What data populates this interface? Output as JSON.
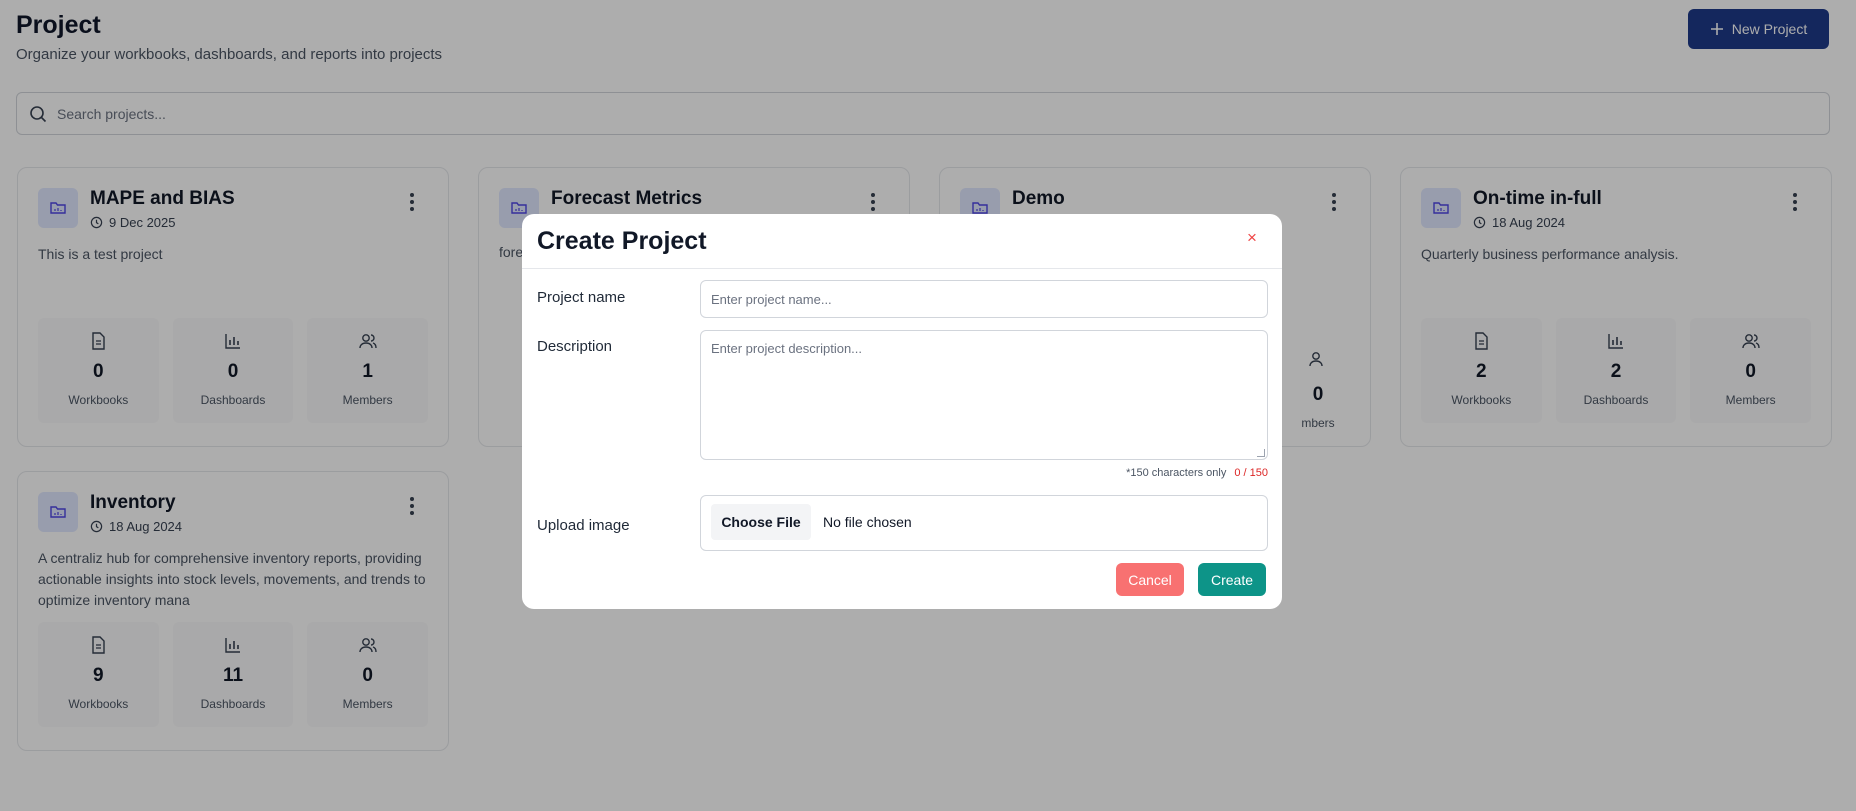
{
  "header": {
    "title": "Project",
    "subtitle": "Organize your workbooks, dashboards, and reports into projects",
    "new_button_label": "New Project"
  },
  "search": {
    "placeholder": "Search projects..."
  },
  "projects": [
    {
      "name": "MAPE and BIAS",
      "date": "9 Dec 2025",
      "description": "This is a test project",
      "workbooks": "0",
      "dashboards": "0",
      "members": "1"
    },
    {
      "name": "Forecast Metrics",
      "date": "",
      "description": "fore",
      "workbooks": "",
      "dashboards": "",
      "members": ""
    },
    {
      "name": "Demo",
      "date": "",
      "description": "",
      "workbooks": "",
      "dashboards": "",
      "members": "0"
    },
    {
      "name": "On-time in-full",
      "date": "18 Aug 2024",
      "description": "Quarterly business performance analysis.",
      "workbooks": "2",
      "dashboards": "2",
      "members": "0"
    },
    {
      "name": "Inventory",
      "date": "18 Aug 2024",
      "description": "A centraliz hub for comprehensive inventory reports, providing actionable insights into stock levels, movements, and trends to optimize inventory mana",
      "workbooks": "9",
      "dashboards": "11",
      "members": "0"
    }
  ],
  "stat_labels": {
    "workbooks": "Workbooks",
    "dashboards": "Dashboards",
    "members": "Members",
    "members_partial": "mbers"
  },
  "modal": {
    "title": "Create Project",
    "close": "×",
    "name_label": "Project name",
    "name_placeholder": "Enter project name...",
    "description_label": "Description",
    "description_placeholder": "Enter project description...",
    "char_note": "*150 characters only",
    "char_count": "0 / 150",
    "upload_label": "Upload image",
    "choose_file_label": "Choose File",
    "no_file_text": "No file chosen",
    "cancel_label": "Cancel",
    "create_label": "Create"
  },
  "colors": {
    "primary": "#1e3a8a",
    "create": "#0d9488",
    "cancel": "#f87171",
    "overlay": "rgba(0,0,0,0.32)"
  },
  "icons": [
    "plus-icon",
    "search-icon",
    "folder-icon",
    "clock-icon",
    "kebab-icon",
    "document-icon",
    "bar-chart-icon",
    "users-icon",
    "close-icon"
  ]
}
